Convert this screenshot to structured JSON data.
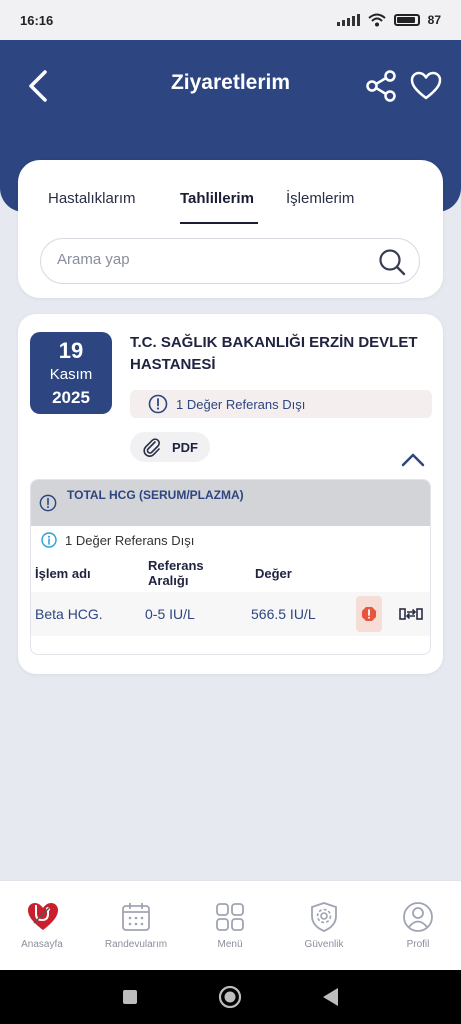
{
  "status_bar": {
    "time": "16:16",
    "battery": "87"
  },
  "header": {
    "title": "Ziyaretlerim"
  },
  "tabs": [
    {
      "label": "Hastalıklarım"
    },
    {
      "label": "Tahlillerim"
    },
    {
      "label": "İşlemlerim"
    }
  ],
  "active_tab": "Tahlillerim",
  "search": {
    "placeholder": "Arama yap"
  },
  "visit": {
    "day": "19",
    "month": "Kasım",
    "year": "2025",
    "hospital": "T.C. SAĞLIK BAKANLIĞI ERZİN DEVLET HASTANESİ",
    "alert": "1 Değer Referans Dışı",
    "pdf_label": "PDF",
    "test": {
      "name": "TOTAL HCG (SERUM/PLAZMA)",
      "note": "1 Değer Referans Dışı",
      "columns": {
        "name": "İşlem adı",
        "range": "Referans Aralığı",
        "value": "Değer"
      },
      "rows": [
        {
          "name": "Beta HCG.",
          "range": "0-5 IU/L",
          "value": "566.5 IU/L"
        }
      ]
    }
  },
  "bottom_nav": [
    {
      "label": "Anasayfa",
      "icon": "heart-stethoscope-icon"
    },
    {
      "label": "Randevularım",
      "icon": "calendar-icon"
    },
    {
      "label": "Menü",
      "icon": "grid-icon"
    },
    {
      "label": "Güvenlik",
      "icon": "shield-gear-icon"
    },
    {
      "label": "Profil",
      "icon": "user-icon"
    }
  ],
  "colors": {
    "primary": "#2d4681",
    "alert_bg": "#f5eeee",
    "warning": "#e8553e"
  }
}
